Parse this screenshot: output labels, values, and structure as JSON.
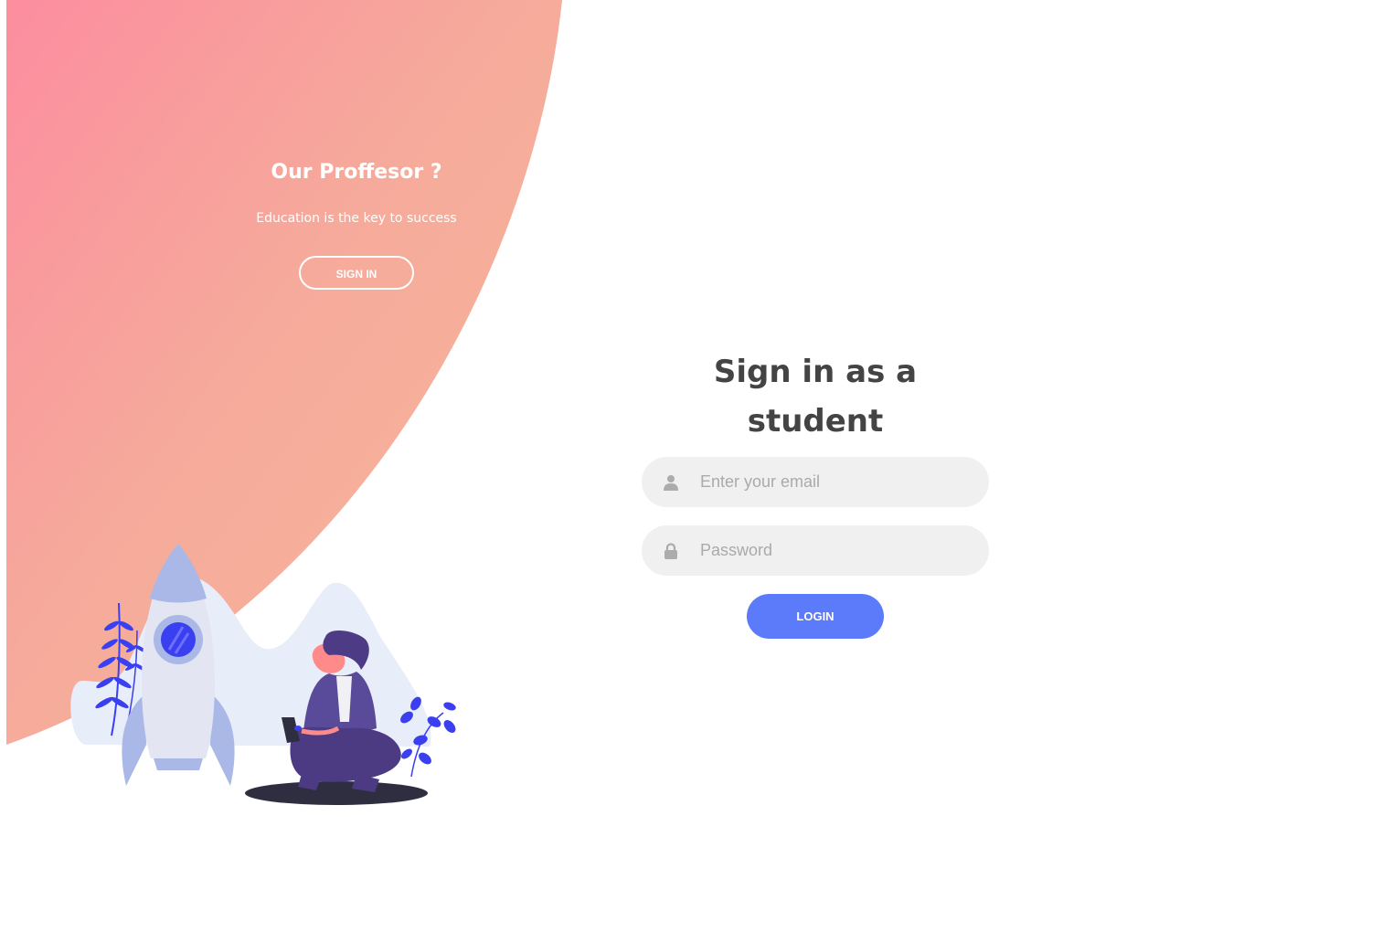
{
  "panel": {
    "title": "Our Proffesor ?",
    "subtitle": "Education is the key to success",
    "signin_label": "SIGN IN"
  },
  "form": {
    "title": "Sign in as a student",
    "email_placeholder": "Enter your email",
    "password_placeholder": "Password",
    "login_label": "LOGIN"
  },
  "icons": {
    "email_field": "user-icon",
    "password_field": "lock-icon"
  },
  "colors": {
    "gradient_start": "#fc8f9f",
    "gradient_end": "#f5b59b",
    "accent": "#5c7bfa",
    "field_bg": "#f0f0f0",
    "title_text": "#444444"
  }
}
